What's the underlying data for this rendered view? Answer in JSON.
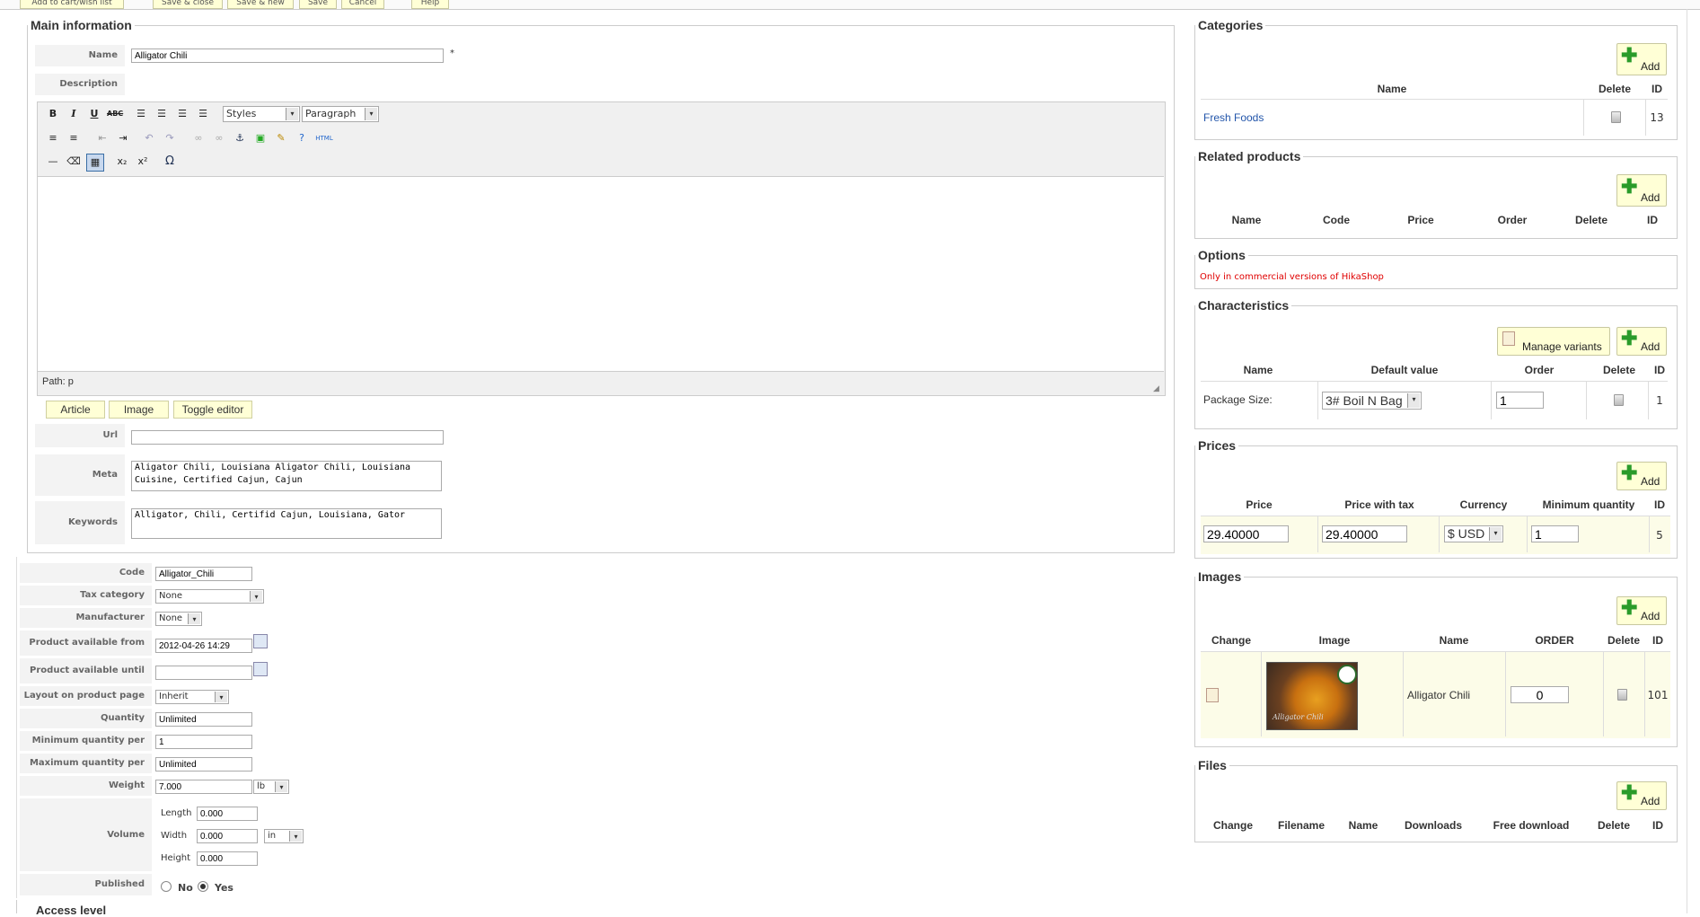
{
  "toolbar": {
    "btn1": "Add to cart/wish list",
    "btn2": "Save & close",
    "btn3": "Save & new",
    "btn4": "Save",
    "btn5": "Cancel",
    "btn6": "Help"
  },
  "main_info": {
    "legend": "Main information",
    "name_label": "Name",
    "name_value": "Alligator Chili",
    "required_mark": "*",
    "description_label": "Description",
    "editor": {
      "styles": "Styles",
      "format": "Paragraph",
      "path": "Path: p",
      "tab_article": "Article",
      "tab_image": "Image",
      "tab_toggle": "Toggle editor"
    },
    "url_label": "Url",
    "url_value": "",
    "meta_label": "Meta description",
    "meta_value": "Aligator Chili, Louisiana Aligator Chili, Louisiana Cuisine, Certified Cajun, Cajun",
    "keywords_label": "Keywords",
    "keywords_value": "Alligator, Chili, Certifid Cajun, Louisiana, Gator"
  },
  "fields": {
    "code_label": "Code",
    "code_value": "Alligator_Chili",
    "tax_label": "Tax category",
    "tax_value": "None",
    "manufacturer_label": "Manufacturer",
    "manufacturer_value": "None",
    "avail_from_label": "Product available from",
    "avail_from_value": "2012-04-26 14:29",
    "avail_until_label": "Product available until",
    "avail_until_value": "",
    "layout_label": "Layout on product page",
    "layout_value": "Inherit",
    "quantity_label": "Quantity",
    "quantity_value": "Unlimited",
    "min_qty_label": "Minimum quantity per order",
    "min_qty_value": "1",
    "max_qty_label": "Maximum quantity per order",
    "max_qty_value": "Unlimited",
    "weight_label": "Weight",
    "weight_value": "7.000",
    "weight_unit": "lb",
    "volume_label": "Volume",
    "length_label": "Length",
    "length_value": "0.000",
    "width_label": "Width",
    "width_value": "0.000",
    "volume_unit": "in",
    "height_label": "Height",
    "height_value": "0.000",
    "published_label": "Published",
    "published_no": "No",
    "published_yes": "Yes",
    "access_label": "Access level"
  },
  "categories": {
    "legend": "Categories",
    "add": "Add",
    "col_name": "Name",
    "col_delete": "Delete",
    "col_id": "ID",
    "row_name": "Fresh Foods",
    "row_id": "13"
  },
  "related": {
    "legend": "Related products",
    "add": "Add",
    "col_name": "Name",
    "col_code": "Code",
    "col_price": "Price",
    "col_order": "Order",
    "col_delete": "Delete",
    "col_id": "ID"
  },
  "options": {
    "legend": "Options",
    "note": "Only in commercial versions of HikaShop"
  },
  "characteristics": {
    "legend": "Characteristics",
    "manage": "Manage variants",
    "add": "Add",
    "col_name": "Name",
    "col_default": "Default value",
    "col_order": "Order",
    "col_delete": "Delete",
    "col_id": "ID",
    "row_name": "Package Size:",
    "row_default": "3# Boil N Bag",
    "row_order": "1",
    "row_id": "1"
  },
  "prices": {
    "legend": "Prices",
    "add": "Add",
    "col_price": "Price",
    "col_price_tax": "Price with tax",
    "col_currency": "Currency",
    "col_min_qty": "Minimum quantity",
    "col_id": "ID",
    "row_price": "29.40000",
    "row_price_tax": "29.40000",
    "row_currency": "$ USD",
    "row_min_qty": "1",
    "row_id": "5"
  },
  "images": {
    "legend": "Images",
    "add": "Add",
    "col_change": "Change",
    "col_image": "Image",
    "col_name": "Name",
    "col_order": "ORDER",
    "col_delete": "Delete",
    "col_id": "ID",
    "row_name": "Alligator Chili",
    "row_order": "0",
    "row_id": "101",
    "thumb_caption": "Alligator Chili"
  },
  "files": {
    "legend": "Files",
    "add": "Add",
    "col_change": "Change",
    "col_filename": "Filename",
    "col_name": "Name",
    "col_downloads": "Downloads",
    "col_free": "Free download",
    "col_delete": "Delete",
    "col_id": "ID"
  },
  "colors": {
    "highlight_row": "#fcfce8",
    "link": "#2255aa",
    "note_red": "#e00000",
    "add_green": "#2a9b2a"
  }
}
